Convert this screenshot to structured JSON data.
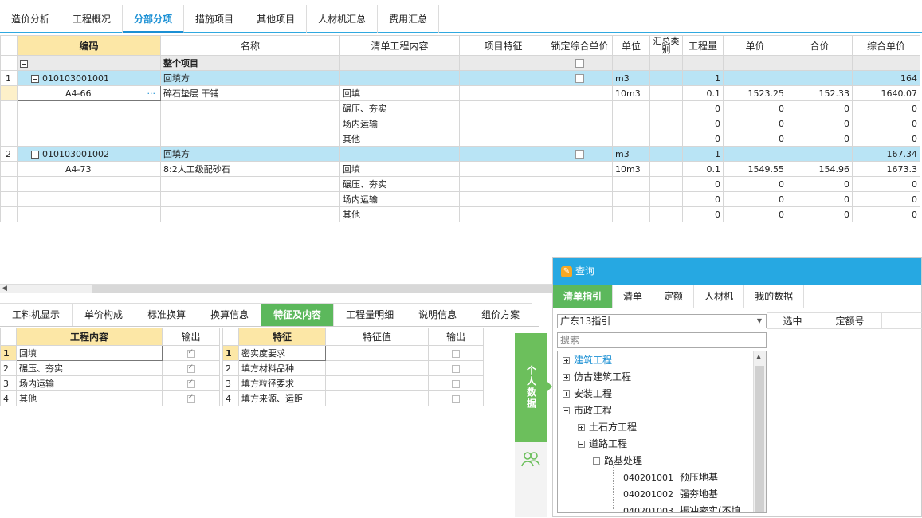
{
  "top_tabs": [
    "造价分析",
    "工程概况",
    "分部分项",
    "措施项目",
    "其他项目",
    "人材机汇总",
    "费用汇总"
  ],
  "active_top_tab": "分部分项",
  "grid": {
    "headers": {
      "code": "编码",
      "name": "名称",
      "content": "清单工程内容",
      "feature": "项目特征",
      "lock": "锁定综合单价",
      "unit": "单位",
      "summary": "汇总类别",
      "qty": "工程量",
      "price": "单价",
      "total": "合价",
      "unit_price": "综合单价"
    },
    "section": {
      "name": "整个项目"
    },
    "bills": [
      {
        "no": "1",
        "code": "010103001001",
        "name": "回填方",
        "unit": "m3",
        "qty": "1",
        "unit_price": "164",
        "quota": {
          "code": "A4-66",
          "name": "碎石垫层 干铺",
          "content": "回填",
          "unit": "10m3",
          "qty": "0.1",
          "price": "1523.25",
          "total": "152.33",
          "unit_price": "1640.07"
        },
        "items": [
          {
            "content": "碾压、夯实",
            "qty": "0",
            "price": "0",
            "total": "0",
            "unit_price": "0"
          },
          {
            "content": "场内运输",
            "qty": "0",
            "price": "0",
            "total": "0",
            "unit_price": "0"
          },
          {
            "content": "其他",
            "qty": "0",
            "price": "0",
            "total": "0",
            "unit_price": "0"
          }
        ]
      },
      {
        "no": "2",
        "code": "010103001002",
        "name": "回填方",
        "unit": "m3",
        "qty": "1",
        "unit_price": "167.34",
        "quota": {
          "code": "A4-73",
          "name": "8:2人工级配砂石",
          "content": "回填",
          "unit": "10m3",
          "qty": "0.1",
          "price": "1549.55",
          "total": "154.96",
          "unit_price": "1673.3"
        },
        "items": [
          {
            "content": "碾压、夯实",
            "qty": "0",
            "price": "0",
            "total": "0",
            "unit_price": "0"
          },
          {
            "content": "场内运输",
            "qty": "0",
            "price": "0",
            "total": "0",
            "unit_price": "0"
          },
          {
            "content": "其他",
            "qty": "0",
            "price": "0",
            "total": "0",
            "unit_price": "0"
          }
        ]
      }
    ],
    "ellipsis": "···"
  },
  "bottom_tabs": [
    "工料机显示",
    "单价构成",
    "标准换算",
    "换算信息",
    "特征及内容",
    "工程量明细",
    "说明信息",
    "组价方案"
  ],
  "active_bottom_tab": "特征及内容",
  "work_table": {
    "headers": {
      "content": "工程内容",
      "output": "输出"
    },
    "rows": [
      {
        "no": "1",
        "content": "回填"
      },
      {
        "no": "2",
        "content": "碾压、夯实"
      },
      {
        "no": "3",
        "content": "场内运输"
      },
      {
        "no": "4",
        "content": "其他"
      }
    ]
  },
  "feature_table": {
    "headers": {
      "feature": "特征",
      "value": "特征值",
      "output": "输出"
    },
    "rows": [
      {
        "no": "1",
        "feature": "密实度要求"
      },
      {
        "no": "2",
        "feature": "填方材料品种"
      },
      {
        "no": "3",
        "feature": "填方粒径要求"
      },
      {
        "no": "4",
        "feature": "填方来源、运距"
      }
    ]
  },
  "side_panel": {
    "label": "个人数据"
  },
  "query_panel": {
    "title": "查询",
    "tabs": [
      "清单指引",
      "清单",
      "定额",
      "人材机",
      "我的数据"
    ],
    "active_tab": "清单指引",
    "dropdown": "广东13指引",
    "search_placeholder": "搜索",
    "columns": [
      "选中",
      "定额号"
    ],
    "tree": [
      {
        "label": "建筑工程"
      },
      {
        "label": "仿古建筑工程"
      },
      {
        "label": "安装工程"
      },
      {
        "label": "市政工程"
      },
      {
        "label": "土石方工程"
      },
      {
        "label": "道路工程"
      },
      {
        "label": "路基处理"
      },
      {
        "code": "040201001",
        "label": "预压地基"
      },
      {
        "code": "040201002",
        "label": "强夯地基"
      },
      {
        "code": "040201003",
        "label": "振冲密实(不填…"
      }
    ]
  },
  "colors": {
    "accent": "#2fa9e0",
    "green": "#5cb85c",
    "header_highlight": "#fce7a6",
    "bill_row": "#b9e4f5"
  }
}
